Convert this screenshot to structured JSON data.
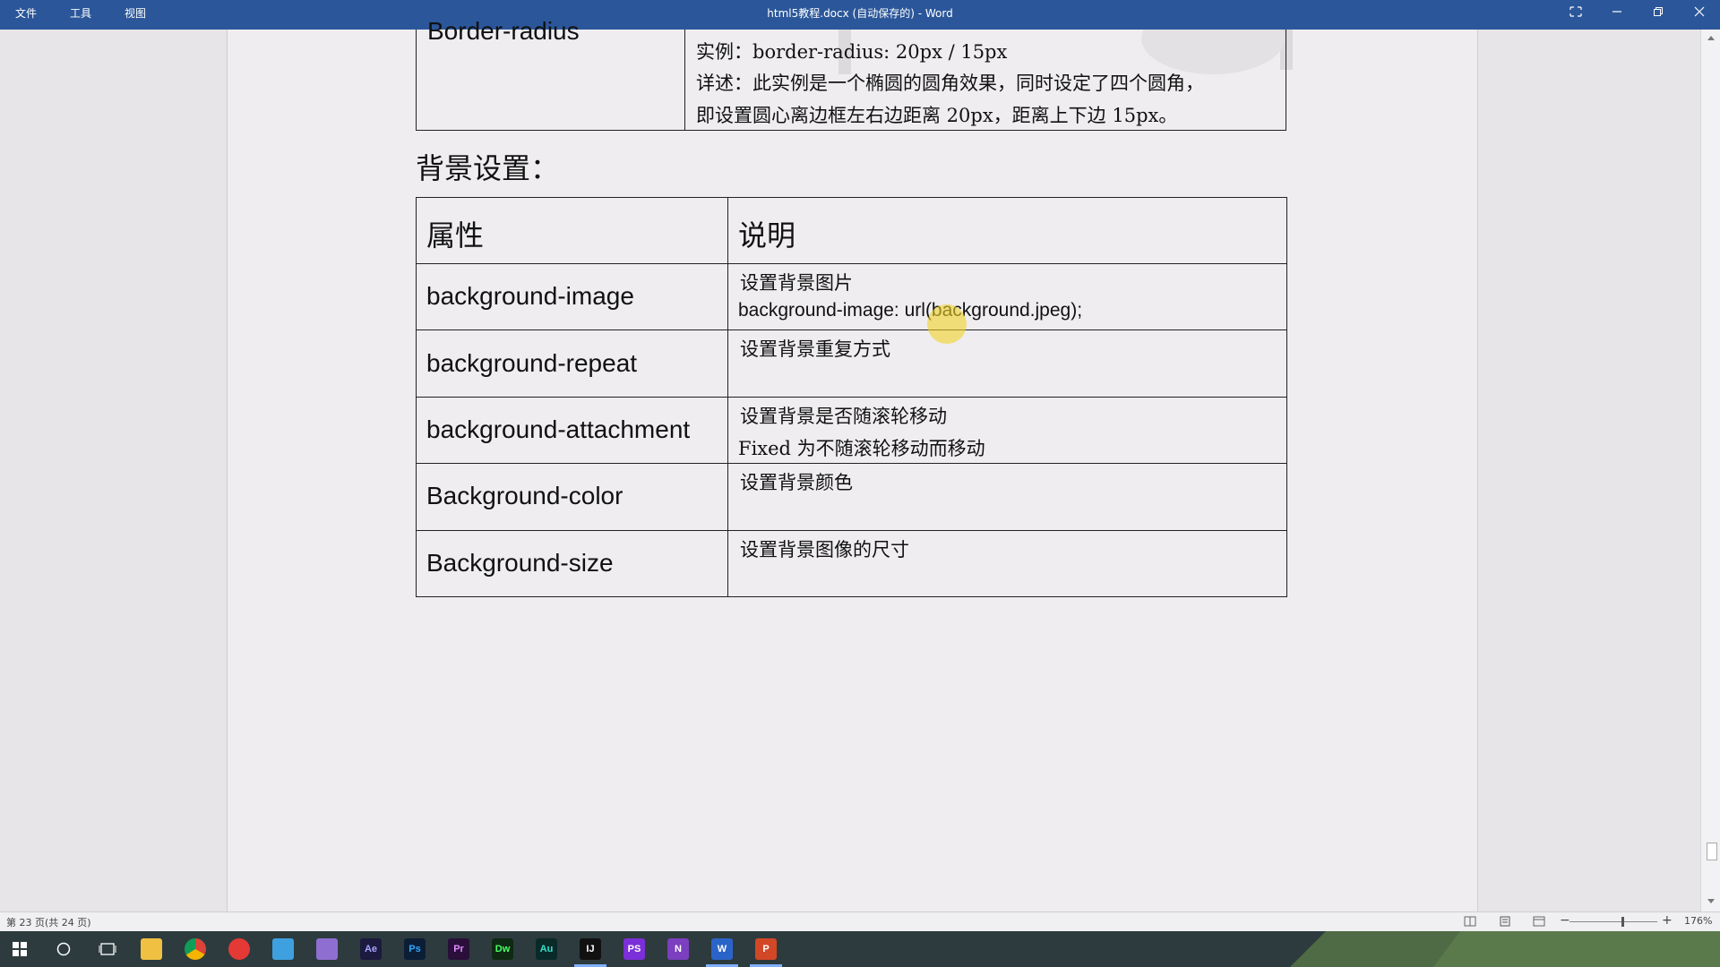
{
  "window": {
    "menus": [
      "文件",
      "工具",
      "视图"
    ],
    "title": "html5教程.docx (自动保存的) - Word"
  },
  "doc": {
    "top_table": {
      "property": "Border-radius",
      "lines": [
        "实例：border-radius: 20px / 15px",
        "详述：此实例是一个椭圆的圆角效果，同时设定了四个圆角，",
        "即设置圆心离边框左右边距离 20px，距离上下边 15px。"
      ]
    },
    "section_heading": "背景设置：",
    "table": {
      "headers": [
        "属性",
        "说明"
      ],
      "rows": [
        {
          "property": "background-image",
          "desc1": "设置背景图片",
          "desc2": "background-image: url(background.jpeg);"
        },
        {
          "property": "background-repeat",
          "desc1": "设置背景重复方式",
          "desc2": ""
        },
        {
          "property": "background-attachment",
          "desc1": "设置背景是否随滚轮移动",
          "desc2": "Fixed 为不随滚轮移动而移动"
        },
        {
          "property": "Background-color",
          "desc1": "设置背景颜色",
          "desc2": ""
        },
        {
          "property": "Background-size",
          "desc1": "设置背景图像的尺寸",
          "desc2": ""
        }
      ]
    }
  },
  "status": {
    "page_info": "第 23 页(共 24 页)",
    "zoom": "176%"
  },
  "taskbar": {
    "apps": [
      {
        "name": "file-explorer-icon",
        "label": "",
        "color": "#f0c042",
        "fg": "#f0c042"
      },
      {
        "name": "chrome-icon",
        "label": "",
        "color": "#4caf50",
        "fg": "#fff"
      },
      {
        "name": "netease-music-icon",
        "label": "",
        "color": "#e53935",
        "fg": "#fff"
      },
      {
        "name": "network-app-icon",
        "label": "",
        "color": "#3fa0e0",
        "fg": "#fff"
      },
      {
        "name": "visual-studio-icon",
        "label": "",
        "color": "#8e6fd1",
        "fg": "#fff"
      },
      {
        "name": "after-effects-icon",
        "label": "Ae",
        "color": "#1c1a3f",
        "fg": "#a6a6ff"
      },
      {
        "name": "photoshop-icon",
        "label": "Ps",
        "color": "#0b1e36",
        "fg": "#31a8ff"
      },
      {
        "name": "premiere-icon",
        "label": "Pr",
        "color": "#2a0f3a",
        "fg": "#e08cff"
      },
      {
        "name": "dreamweaver-icon",
        "label": "Dw",
        "color": "#0e2a12",
        "fg": "#4cff6a"
      },
      {
        "name": "audition-icon",
        "label": "Au",
        "color": "#0a2a2a",
        "fg": "#33e0c8"
      },
      {
        "name": "intellij-icon",
        "label": "IJ",
        "color": "#111",
        "fg": "#fff"
      },
      {
        "name": "phpstorm-icon",
        "label": "PS",
        "color": "#7b2fd8",
        "fg": "#fff"
      },
      {
        "name": "onenote-icon",
        "label": "N",
        "color": "#7b3fbf",
        "fg": "#fff"
      },
      {
        "name": "word-icon",
        "label": "W",
        "color": "#2b64c8",
        "fg": "#fff"
      },
      {
        "name": "powerpoint-icon",
        "label": "P",
        "color": "#d24726",
        "fg": "#fff"
      }
    ]
  }
}
